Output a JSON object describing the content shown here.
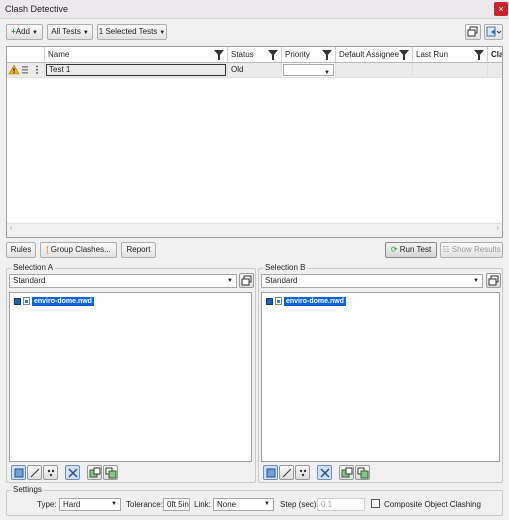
{
  "window": {
    "title": "Clash Detective"
  },
  "toolbar": {
    "add_label": "Add",
    "all_tests_label": "All Tests",
    "selected_tests_label": "1 Selected Tests"
  },
  "grid": {
    "columns": [
      "Name",
      "Status",
      "Priority",
      "Default Assignee",
      "Last Run",
      "Clas"
    ],
    "rows": [
      {
        "name": "Test 1",
        "status": "Old",
        "priority": "",
        "assignee": "",
        "last_run": ""
      }
    ]
  },
  "actions": {
    "rules": "Rules",
    "group_clashes": "Group Clashes...",
    "report": "Report",
    "run_test": "Run Test",
    "show_results": "Show Results"
  },
  "selection_a": {
    "label": "Selection A",
    "set": "Standard",
    "file": "enviro-dome.nwd"
  },
  "selection_b": {
    "label": "Selection B",
    "set": "Standard",
    "file": "enviro-dome.nwd"
  },
  "settings": {
    "label": "Settings",
    "type_label": "Type:",
    "type_value": "Hard",
    "tolerance_label": "Tolerance:",
    "tolerance_value": "0ft 5in",
    "link_label": "Link:",
    "link_value": "None",
    "step_label": "Step (sec):",
    "step_value": "0.1",
    "composite_label": "Composite Object Clashing"
  },
  "colors": {
    "accent": "#0a64d8",
    "close": "#c8242a",
    "warning": "#f2b705"
  }
}
